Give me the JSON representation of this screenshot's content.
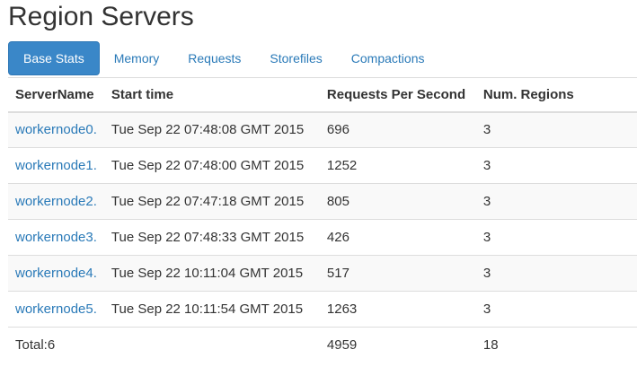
{
  "page": {
    "title": "Region Servers"
  },
  "tabs": [
    {
      "label": "Base Stats",
      "active": true
    },
    {
      "label": "Memory",
      "active": false
    },
    {
      "label": "Requests",
      "active": false
    },
    {
      "label": "Storefiles",
      "active": false
    },
    {
      "label": "Compactions",
      "active": false
    }
  ],
  "table": {
    "headers": {
      "server_name": "ServerName",
      "start_time": "Start time",
      "rps": "Requests Per Second",
      "regions": "Num. Regions"
    },
    "rows": [
      {
        "server": "workernode0.",
        "start": "Tue Sep 22 07:48:08 GMT 2015",
        "rps": "696",
        "regions": "3"
      },
      {
        "server": "workernode1.",
        "start": "Tue Sep 22 07:48:00 GMT 2015",
        "rps": "1252",
        "regions": "3"
      },
      {
        "server": "workernode2.",
        "start": "Tue Sep 22 07:47:18 GMT 2015",
        "rps": "805",
        "regions": "3"
      },
      {
        "server": "workernode3.",
        "start": "Tue Sep 22 07:48:33 GMT 2015",
        "rps": "426",
        "regions": "3"
      },
      {
        "server": "workernode4.",
        "start": "Tue Sep 22 10:11:04 GMT 2015",
        "rps": "517",
        "regions": "3"
      },
      {
        "server": "workernode5.",
        "start": "Tue Sep 22 10:11:54 GMT 2015",
        "rps": "1263",
        "regions": "3"
      }
    ],
    "total": {
      "label": "Total:6",
      "start": "",
      "rps": "4959",
      "regions": "18"
    }
  },
  "colors": {
    "accent": "#3a87c8",
    "link": "#2a7ab8",
    "text": "#333333"
  }
}
